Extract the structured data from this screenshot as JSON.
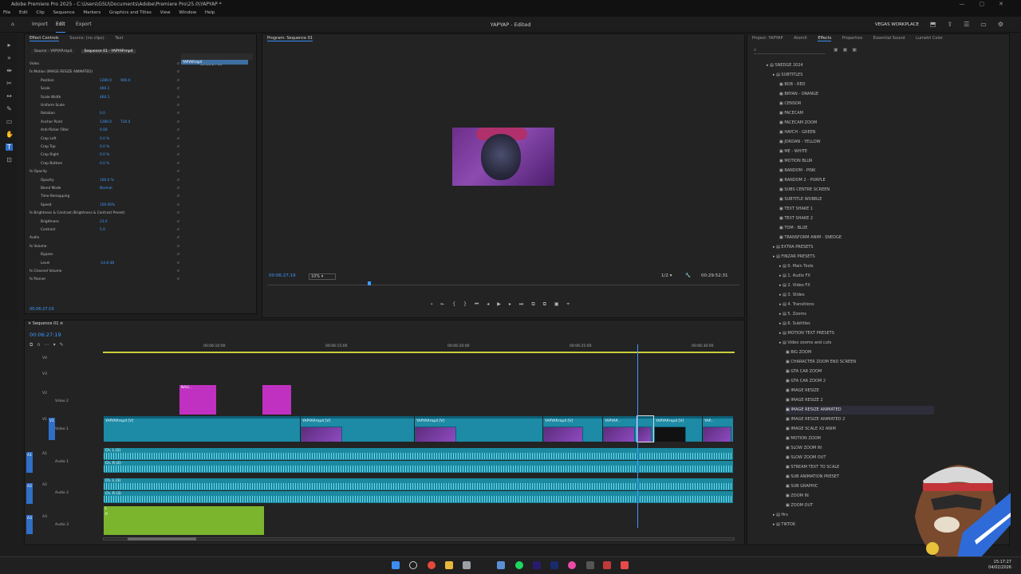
{
  "titlebar": {
    "text": "Adobe Premiere Pro 2025 - C:\\Users\\GSU\\Documents\\Adobe\\Premiere Pro\\25.0\\YAPYAP *"
  },
  "menubar": {
    "items": [
      "File",
      "Edit",
      "Clip",
      "Sequence",
      "Markers",
      "Graphics and Titles",
      "View",
      "Window",
      "Help"
    ]
  },
  "topbar": {
    "tabs": [
      "Import",
      "Edit",
      "Export"
    ],
    "active": "Edit",
    "document": "YAPYAP - Edited",
    "workspace": "VEGAS WORKPLACE"
  },
  "effect_controls": {
    "tabs": [
      "Effect Controls",
      "Source: (no clips)",
      "Text"
    ],
    "source_tabs": [
      "Source - YAPYAP.mp4",
      "Sequence 01 - YAPYAP.mp4"
    ],
    "mini_timecode": "00:06:27:30",
    "mini_clip": "YAPYAP.mp4",
    "rows": [
      {
        "label": "Video",
        "v1": "",
        "v2": ""
      },
      {
        "label": "fx  Motion (IMAGE RESIZE ANIMATED)",
        "v1": "",
        "v2": ""
      },
      {
        "label": "Position",
        "v1": "1280.0",
        "v2": "900.0"
      },
      {
        "label": "Scale",
        "v1": "460.1",
        "v2": ""
      },
      {
        "label": "Scale Width",
        "v1": "460.1",
        "v2": ""
      },
      {
        "label": "Uniform Scale",
        "v1": "",
        "v2": ""
      },
      {
        "label": "Rotation",
        "v1": "0.0",
        "v2": ""
      },
      {
        "label": "Anchor Point",
        "v1": "1280.0",
        "v2": "720.0"
      },
      {
        "label": "Anti-flicker Filter",
        "v1": "0.00",
        "v2": ""
      },
      {
        "label": "Crop Left",
        "v1": "0.0 %",
        "v2": ""
      },
      {
        "label": "Crop Top",
        "v1": "0.0 %",
        "v2": ""
      },
      {
        "label": "Crop Right",
        "v1": "0.0 %",
        "v2": ""
      },
      {
        "label": "Crop Bottom",
        "v1": "0.0 %",
        "v2": ""
      },
      {
        "label": "fx  Opacity",
        "v1": "",
        "v2": ""
      },
      {
        "label": "Opacity",
        "v1": "100.0 %",
        "v2": ""
      },
      {
        "label": "Blend Mode",
        "v1": "Normal",
        "v2": ""
      },
      {
        "label": "Time Remapping",
        "v1": "",
        "v2": ""
      },
      {
        "label": "Speed",
        "v1": "100.00%",
        "v2": ""
      },
      {
        "label": "fx  Brightness & Contrast (Brightness & Contrast Preset)",
        "v1": "",
        "v2": ""
      },
      {
        "label": "Brightness",
        "v1": "23.0",
        "v2": ""
      },
      {
        "label": "Contrast",
        "v1": "5.0",
        "v2": ""
      },
      {
        "label": "Audio",
        "v1": "",
        "v2": ""
      },
      {
        "label": "fx  Volume",
        "v1": "",
        "v2": ""
      },
      {
        "label": "Bypass",
        "v1": "",
        "v2": ""
      },
      {
        "label": "Level",
        "v1": "-14.8 dB",
        "v2": ""
      },
      {
        "label": "fx  Channel Volume",
        "v1": "",
        "v2": ""
      },
      {
        "label": "fx  Panner",
        "v1": "",
        "v2": ""
      }
    ],
    "footer_timecode": "00:06:27:19"
  },
  "program": {
    "tab": "Program: Sequence 01",
    "timecode": "00:06:27:19",
    "zoom": "10%",
    "quality": "1/2",
    "duration": "00:29:52:31"
  },
  "effects": {
    "tabs": [
      "Project: YAPYAP",
      "AtomX",
      "Effects",
      "Properties",
      "Essential Sound",
      "Lumetri Color"
    ],
    "active": "Effects",
    "items": [
      {
        "label": "SNEDGE 2024",
        "indent": 0
      },
      {
        "label": "SUBTITLES",
        "indent": 1
      },
      {
        "label": "BOB - RED",
        "indent": 2
      },
      {
        "label": "BRYAN - ORANGE",
        "indent": 2
      },
      {
        "label": "CENSOR",
        "indent": 2
      },
      {
        "label": "FACECAM",
        "indent": 2
      },
      {
        "label": "FACECAM ZOOM",
        "indent": 2
      },
      {
        "label": "HAYCH - GREEN",
        "indent": 2
      },
      {
        "label": "JORDAN - YELLOW",
        "indent": 2
      },
      {
        "label": "ME - WHITE",
        "indent": 2
      },
      {
        "label": "MOTION BLUR",
        "indent": 2
      },
      {
        "label": "RANDOM - PINK",
        "indent": 2
      },
      {
        "label": "RANDOM 2 - PURPLE",
        "indent": 2
      },
      {
        "label": "SUBS CENTRE SCREEN",
        "indent": 2
      },
      {
        "label": "SUBTITLE WOBBLE",
        "indent": 2
      },
      {
        "label": "TEXT SHAKE 1",
        "indent": 2
      },
      {
        "label": "TEXT SHAKE 2",
        "indent": 2
      },
      {
        "label": "TOM - BLUE",
        "indent": 2
      },
      {
        "label": "TRANSFORM ANIM - SNEDGE",
        "indent": 2
      },
      {
        "label": "EXTRA PRESETS",
        "indent": 1
      },
      {
        "label": "FINZAR PRESETS",
        "indent": 1
      },
      {
        "label": "0. Main Tools",
        "indent": 2
      },
      {
        "label": "1. Audio FX",
        "indent": 2
      },
      {
        "label": "2. Video FX",
        "indent": 2
      },
      {
        "label": "3. Slides",
        "indent": 2
      },
      {
        "label": "4. Transitions",
        "indent": 2
      },
      {
        "label": "5. Zooms",
        "indent": 2
      },
      {
        "label": "6. Subtitles",
        "indent": 2
      },
      {
        "label": "MOTION TEXT PRESETS",
        "indent": 2
      },
      {
        "label": "Video zooms and cuts",
        "indent": 2
      },
      {
        "label": "BIG ZOOM",
        "indent": 3
      },
      {
        "label": "CHARACTER ZOOM END SCREEN",
        "indent": 3
      },
      {
        "label": "GTA CAR ZOOM",
        "indent": 3
      },
      {
        "label": "GTA CAR ZOOM 2",
        "indent": 3
      },
      {
        "label": "IMAGE RESIZE",
        "indent": 3
      },
      {
        "label": "IMAGE RESIZE 2",
        "indent": 3
      },
      {
        "label": "IMAGE RESIZE ANIMATED",
        "indent": 3
      },
      {
        "label": "IMAGE RESIZE ANIMATED 2",
        "indent": 3
      },
      {
        "label": "IMAGE SCALE X2 ANIM",
        "indent": 3
      },
      {
        "label": "MOTION ZOOM",
        "indent": 3
      },
      {
        "label": "SLOW ZOOM IN",
        "indent": 3
      },
      {
        "label": "SLOW ZOOM OUT",
        "indent": 3
      },
      {
        "label": "STREAM TEXT TO SCALE",
        "indent": 3
      },
      {
        "label": "SUB ANIMATION PRESET",
        "indent": 3
      },
      {
        "label": "SUB GRAPHIC",
        "indent": 3
      },
      {
        "label": "ZOOM IN",
        "indent": 3
      },
      {
        "label": "ZOOM OUT",
        "indent": 3
      },
      {
        "label": "Hrs",
        "indent": 1
      },
      {
        "label": "TIKTOK",
        "indent": 1
      }
    ],
    "highlighted": "IMAGE RESIZE ANIMATED"
  },
  "timeline": {
    "tab": "Sequence 01",
    "timecode": "00:06:27:19",
    "ruler": [
      "00:06:10:00",
      "00:06:15:00",
      "00:06:20:00",
      "00:06:25:00",
      "00:06:30:00"
    ],
    "tracks": [
      "V4",
      "V3",
      "V2",
      "Video 2",
      "V1",
      "Video 1",
      "A1",
      "Audio 1",
      "A2",
      "Audio 2",
      "A3",
      "Audio 3"
    ],
    "graphic_clip": "NAU...",
    "video_clip": "YAPYAP.mp4 [V]",
    "video_clip_short": "YAPYAP...",
    "video_clip_tiny": "YAP...",
    "audio_left": "Ch. L (2)",
    "audio_right": "Ch. R (2)",
    "audio_left3": "Ch. L (3)",
    "audio_right3": "Ch. R (3)",
    "graph_l": "L",
    "graph_r": "R"
  },
  "taskbar": {
    "time": "15:17:27",
    "date": "04/02/2026"
  }
}
